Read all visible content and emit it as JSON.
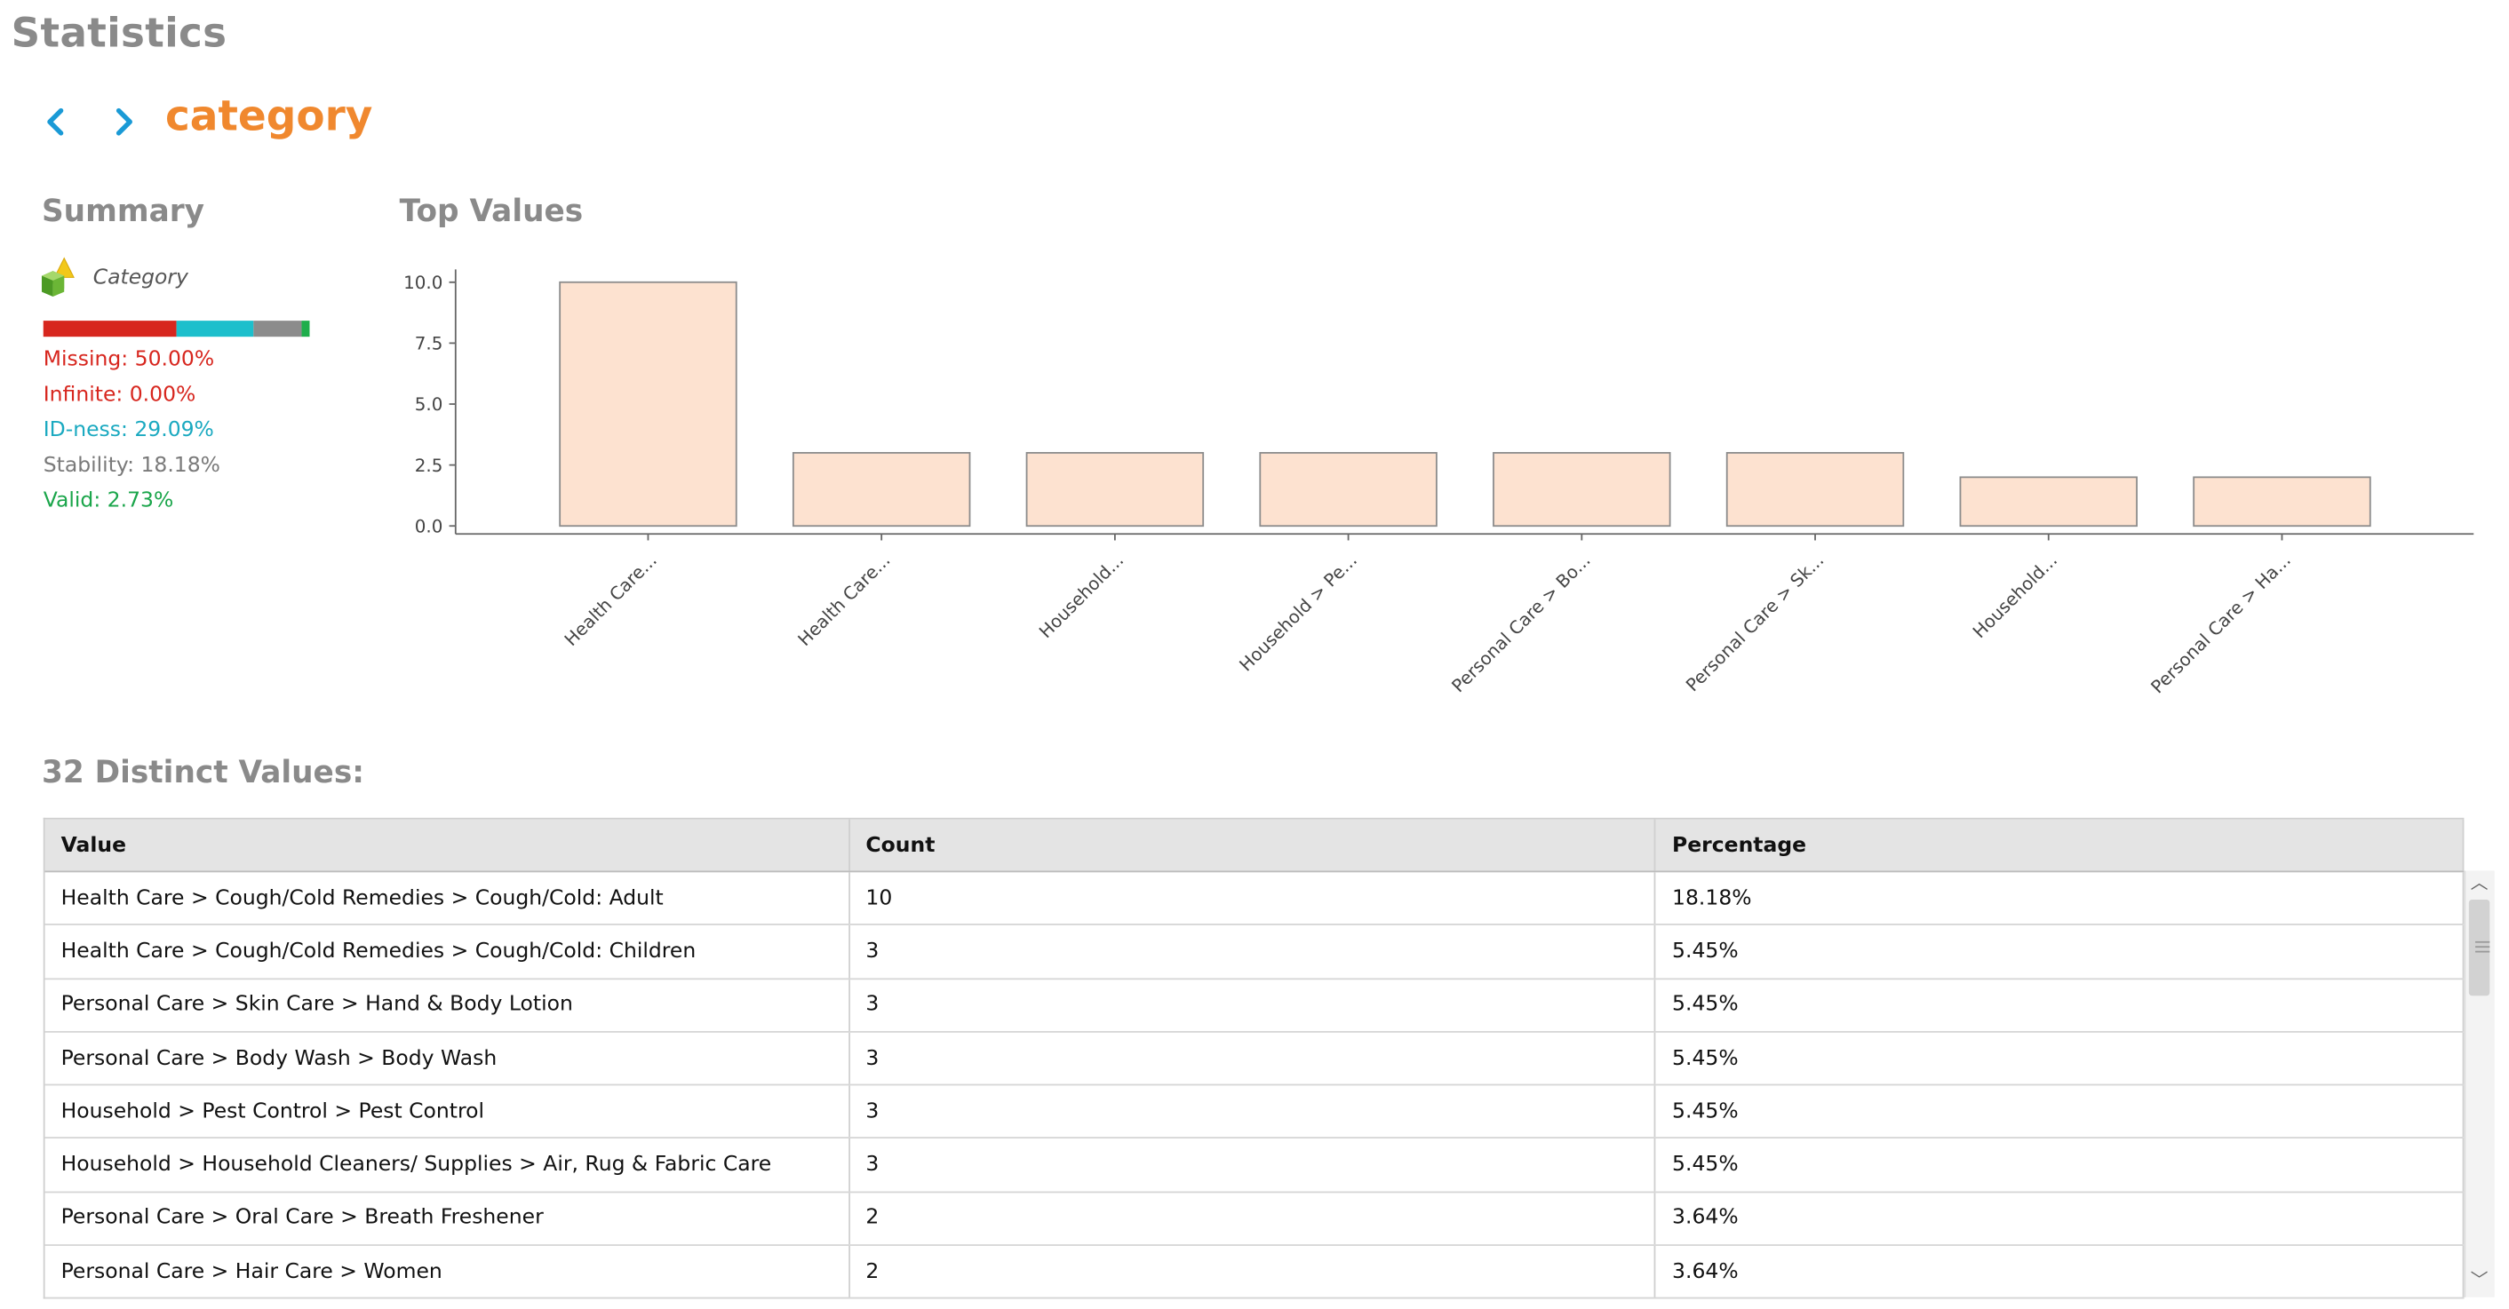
{
  "header": {
    "title": "Statistics",
    "attribute_name": "category"
  },
  "summary": {
    "title": "Summary",
    "type_label": "Category",
    "quality_bar": [
      {
        "name": "missing",
        "fraction": 0.5,
        "color": "#d7261e"
      },
      {
        "name": "id-ness",
        "fraction": 0.2909,
        "color": "#1dbfcc"
      },
      {
        "name": "stability",
        "fraction": 0.1818,
        "color": "#8c8c8c"
      },
      {
        "name": "valid",
        "fraction": 0.0273,
        "color": "#1fae4b"
      }
    ],
    "stats": [
      {
        "label": "Missing: 50.00%",
        "color": "#d7261e"
      },
      {
        "label": "Infinite: 0.00%",
        "color": "#d7261e"
      },
      {
        "label": "ID-ness: 29.09%",
        "color": "#1aa9c0"
      },
      {
        "label": "Stability: 18.18%",
        "color": "#7a7a7a"
      },
      {
        "label": "Valid: 2.73%",
        "color": "#1aa54a"
      }
    ]
  },
  "top_values": {
    "title": "Top Values"
  },
  "chart_data": {
    "type": "bar",
    "categories": [
      "Health Care...",
      "Health Care...",
      "Household...",
      "Household > Pe...",
      "Personal Care > Bo...",
      "Personal Care > Sk...",
      "Household...",
      "Personal Care > Ha..."
    ],
    "values": [
      10,
      3,
      3,
      3,
      3,
      3,
      2,
      2
    ],
    "yticks": [
      "0.0",
      "2.5",
      "5.0",
      "7.5",
      "10.0"
    ],
    "ylim": [
      0,
      10
    ],
    "bar_fill": "#fde2d0",
    "bar_stroke": "#8c8c8c"
  },
  "distinct": {
    "title": "32 Distinct Values:",
    "columns": [
      "Value",
      "Count",
      "Percentage"
    ],
    "rows": [
      [
        "Health Care > Cough/Cold Remedies > Cough/Cold: Adult",
        "10",
        "18.18%"
      ],
      [
        "Health Care > Cough/Cold Remedies > Cough/Cold: Children",
        "3",
        "5.45%"
      ],
      [
        "Personal Care > Skin Care > Hand & Body Lotion",
        "3",
        "5.45%"
      ],
      [
        "Personal Care > Body Wash > Body Wash",
        "3",
        "5.45%"
      ],
      [
        "Household > Pest Control > Pest Control",
        "3",
        "5.45%"
      ],
      [
        "Household > Household Cleaners/ Supplies > Air, Rug & Fabric Care",
        "3",
        "5.45%"
      ],
      [
        "Personal Care > Oral Care > Breath Freshener",
        "2",
        "3.64%"
      ],
      [
        "Personal Care > Hair Care > Women",
        "2",
        "3.64%"
      ]
    ]
  },
  "icons": {
    "back": "chevron-left-icon",
    "forward": "chevron-right-icon",
    "type": "nominal-type-icon",
    "nav_color": "#1a9ad6"
  }
}
